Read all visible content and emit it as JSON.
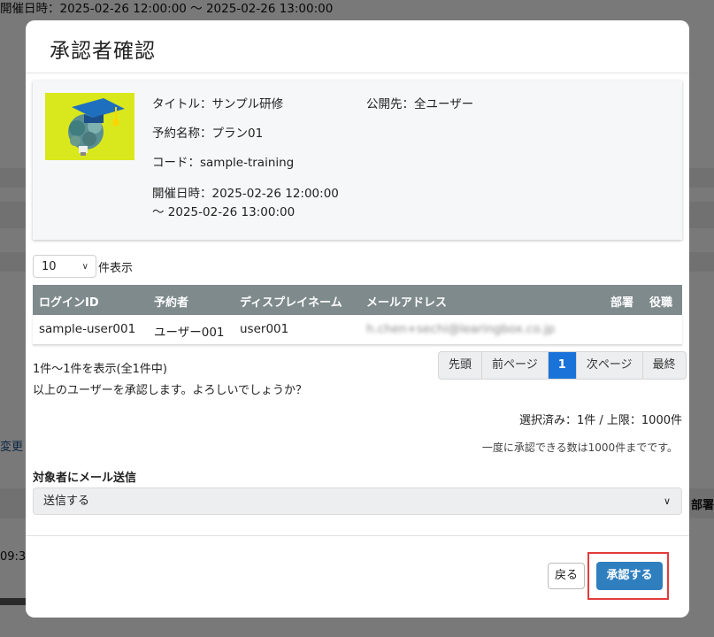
{
  "background": {
    "top_text": "開催日時：2025-02-26 12:00:00 ～ 2025-02-26 13:00:00",
    "left_link": "変更",
    "left_time": "09:3",
    "right_header": "部署"
  },
  "modal": {
    "title": "承認者確認",
    "training": {
      "title_line": "タイトル：サンプル研修",
      "publish_line": "公開先：全ユーザー",
      "plan_line": "予約名称：プラン01",
      "code_line": "コード：sample-training",
      "date_line1": "開催日時：2025-02-26 12:00:00",
      "date_line2": "～ 2025-02-26 13:00:00"
    },
    "page_size": {
      "value": "10",
      "label": "件表示"
    },
    "table": {
      "headers": [
        "ログインID",
        "予約者",
        "ディスプレイネーム",
        "メールアドレス",
        "部署",
        "役職"
      ],
      "rows": [
        {
          "login_id": "sample-user001",
          "name": "ユーザー001",
          "display": "user001",
          "email": "h.chen+sechi@learingbox.co.jp",
          "dept": "",
          "role": ""
        }
      ]
    },
    "count_text": "1件～1件を表示(全1件中)",
    "confirm_text": "以上のユーザーを承認します。よろしいでしょうか？",
    "pager": {
      "first": "先頭",
      "prev": "前ページ",
      "current": "1",
      "next": "次ページ",
      "last": "最終"
    },
    "selected_text": "選択済み：1件 / 上限：1000件",
    "limit_note": "一度に承認できる数は1000件までです。",
    "mail": {
      "label": "対象者にメール送信",
      "value": "送信する"
    },
    "buttons": {
      "back": "戻る",
      "approve": "承認する"
    },
    "colors": {
      "approve": "#2f7fbf",
      "table_header": "#7e8a8c",
      "pager_active": "#1a73d9",
      "highlight": "#e23b3b"
    }
  }
}
